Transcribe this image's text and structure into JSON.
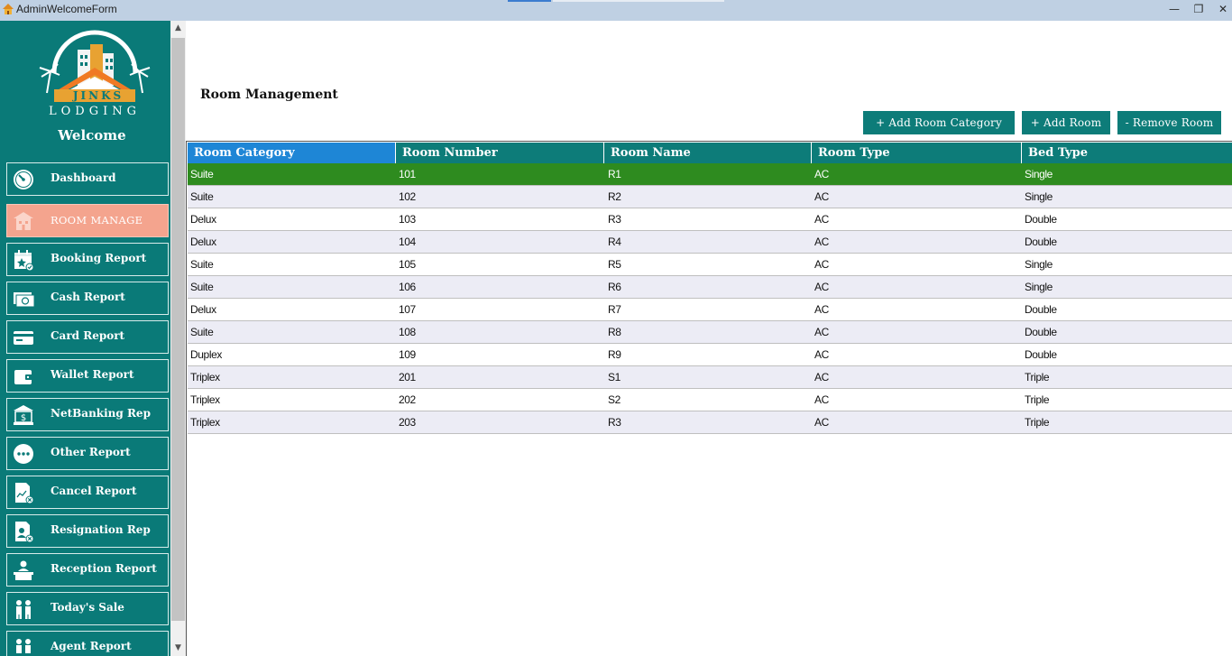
{
  "window": {
    "title": "AdminWelcomeForm",
    "minimize_glyph": "—",
    "restore_glyph": "❐",
    "close_glyph": "✕"
  },
  "sidebar": {
    "logo_text_top": "JINKS",
    "logo_text_bottom": "LODGING",
    "welcome": "Welcome",
    "items": [
      {
        "label": "Dashboard",
        "icon": "speedometer-icon"
      },
      {
        "label": "ROOM MANAGE",
        "icon": "hotel-icon",
        "active": true
      },
      {
        "label": "Booking Report",
        "icon": "calendar-star-icon"
      },
      {
        "label": "Cash Report",
        "icon": "cash-icon"
      },
      {
        "label": "Card Report",
        "icon": "credit-card-icon"
      },
      {
        "label": "Wallet Report",
        "icon": "wallet-icon"
      },
      {
        "label": "NetBanking Rep",
        "icon": "bank-icon"
      },
      {
        "label": "Other Report",
        "icon": "more-dots-icon"
      },
      {
        "label": "Cancel Report",
        "icon": "cancel-chart-icon"
      },
      {
        "label": "Resignation Rep",
        "icon": "resignation-doc-icon"
      },
      {
        "label": "Reception Report",
        "icon": "reception-desk-icon"
      },
      {
        "label": "Today's Sale",
        "icon": "people-sale-icon"
      },
      {
        "label": "Agent Report",
        "icon": "agent-icon"
      }
    ],
    "colors": {
      "background": "#0a7a78",
      "active": "#f4a48e"
    }
  },
  "main": {
    "title": "Room Management",
    "buttons": {
      "add_category": "+ Add Room Category",
      "add_room": "+ Add Room",
      "remove_room": "- Remove Room"
    },
    "table": {
      "columns": [
        "Room Category",
        "Room Number",
        "Room Name",
        "Room Type",
        "Bed Type"
      ],
      "selected_row": 0,
      "rows": [
        [
          "Suite",
          "101",
          "R1",
          "AC",
          "Single"
        ],
        [
          "Suite",
          "102",
          "R2",
          "AC",
          "Single"
        ],
        [
          "Delux",
          "103",
          "R3",
          "AC",
          "Double"
        ],
        [
          "Delux",
          "104",
          "R4",
          "AC",
          "Double"
        ],
        [
          "Suite",
          "105",
          "R5",
          "AC",
          "Single"
        ],
        [
          "Suite",
          "106",
          "R6",
          "AC",
          "Single"
        ],
        [
          "Delux",
          "107",
          "R7",
          "AC",
          "Double"
        ],
        [
          "Suite",
          "108",
          "R8",
          "AC",
          "Double"
        ],
        [
          "Duplex",
          "109",
          "R9",
          "AC",
          "Double"
        ],
        [
          "Triplex",
          "201",
          "S1",
          "AC",
          "Triple"
        ],
        [
          "Triplex",
          "202",
          "S2",
          "AC",
          "Triple"
        ],
        [
          "Triplex",
          "203",
          "R3",
          "AC",
          "Triple"
        ]
      ]
    },
    "colors": {
      "header": "#0d7c79",
      "header_selected": "#1e86d6",
      "row_selected": "#2e8b1f",
      "row_alt": "#ececf5"
    }
  }
}
